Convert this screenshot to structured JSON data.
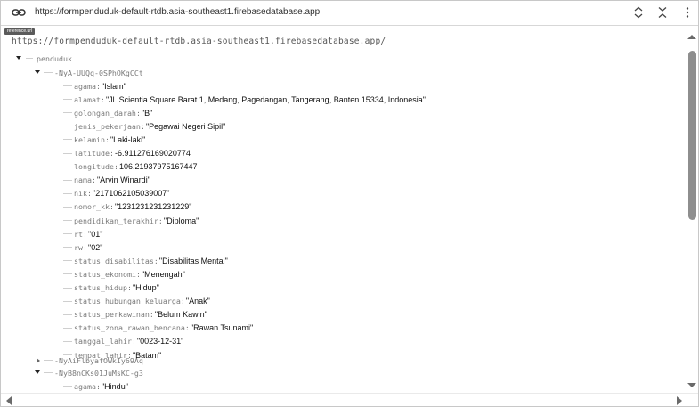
{
  "topbar": {
    "url": "https://formpenduduk-default-rtdb.asia-southeast1.firebasedatabase.app",
    "icons": [
      "link-icon",
      "unfold-icon",
      "collapse-icon",
      "more-vert-icon"
    ]
  },
  "badge": "reference.url",
  "root_url": "https://formpenduduk-default-rtdb.asia-southeast1.firebasedatabase.app/",
  "tree": {
    "root_key": "penduduk",
    "record1": {
      "key": "-NyA-UUQq-0SPhOKgCCt",
      "fields": [
        {
          "key": "agama",
          "value": "\"Islam\""
        },
        {
          "key": "alamat",
          "value": "\"Jl. Scientia Square Barat 1, Medang, Pagedangan, Tangerang, Banten 15334, Indonesia\""
        },
        {
          "key": "golongan_darah",
          "value": "\"B\""
        },
        {
          "key": "jenis_pekerjaan",
          "value": "\"Pegawai Negeri Sipil\""
        },
        {
          "key": "kelamin",
          "value": "\"Laki-laki\""
        },
        {
          "key": "latitude",
          "value": "-6.911276169020774"
        },
        {
          "key": "longitude",
          "value": "106.21937975167447"
        },
        {
          "key": "nama",
          "value": "\"Arvin Winardi\""
        },
        {
          "key": "nik",
          "value": "\"2171062105039007\""
        },
        {
          "key": "nomor_kk",
          "value": "\"1231231231231229\""
        },
        {
          "key": "pendidikan_terakhir",
          "value": "\"Diploma\""
        },
        {
          "key": "rt",
          "value": "\"01\""
        },
        {
          "key": "rw",
          "value": "\"02\""
        },
        {
          "key": "status_disabilitas",
          "value": "\"Disabilitas Mental\""
        },
        {
          "key": "status_ekonomi",
          "value": "\"Menengah\""
        },
        {
          "key": "status_hidup",
          "value": "\"Hidup\""
        },
        {
          "key": "status_hubungan_keluarga",
          "value": "\"Anak\""
        },
        {
          "key": "status_perkawinan",
          "value": "\"Belum Kawin\""
        },
        {
          "key": "status_zona_rawan_bencana",
          "value": "\"Rawan Tsunami\""
        },
        {
          "key": "tanggal_lahir",
          "value": "\"0023-12-31\""
        },
        {
          "key": "tempat_lahir",
          "value": "\"Batam\""
        }
      ]
    },
    "record2": {
      "key": "-NyAiFlbyafOWkIy69Aq"
    },
    "record3": {
      "key": "-NyB8nCKs01JuMsKC-g3",
      "fields": [
        {
          "key": "agama",
          "value": "\"Hindu\""
        }
      ]
    }
  }
}
